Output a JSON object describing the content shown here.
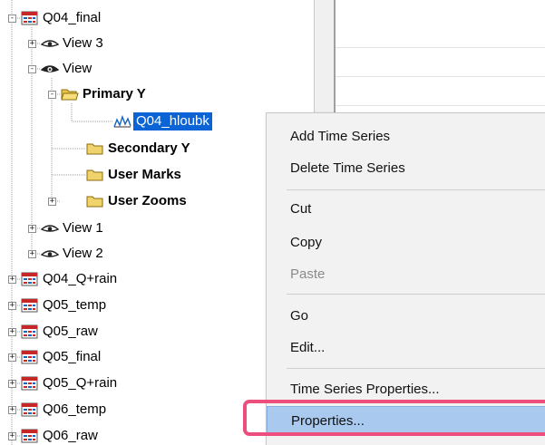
{
  "tree": {
    "items": [
      {
        "label": "Q04_final",
        "exp": "-"
      },
      {
        "label": "View 3",
        "exp": "+"
      },
      {
        "label": "View",
        "exp": "-"
      },
      {
        "label": "Primary Y",
        "exp": "-"
      },
      {
        "label": "Q04_hloubk",
        "exp": ""
      },
      {
        "label": "Secondary Y",
        "exp": ""
      },
      {
        "label": "User Marks",
        "exp": ""
      },
      {
        "label": "User Zooms",
        "exp": "+"
      },
      {
        "label": "View 1",
        "exp": "+"
      },
      {
        "label": "View 2",
        "exp": "+"
      },
      {
        "label": "Q04_Q+rain",
        "exp": "+"
      },
      {
        "label": "Q05_temp",
        "exp": "+"
      },
      {
        "label": "Q05_raw",
        "exp": "+"
      },
      {
        "label": "Q05_final",
        "exp": "+"
      },
      {
        "label": "Q05_Q+rain",
        "exp": "+"
      },
      {
        "label": "Q06_temp",
        "exp": "+"
      },
      {
        "label": "Q06_raw",
        "exp": "+"
      }
    ]
  },
  "context_menu": {
    "items": [
      {
        "label": "Add Time Series",
        "enabled": true
      },
      {
        "label": "Delete Time Series",
        "enabled": true
      },
      {
        "label": "Cut",
        "enabled": true
      },
      {
        "label": "Copy",
        "enabled": true
      },
      {
        "label": "Paste",
        "enabled": false
      },
      {
        "label": "Go",
        "enabled": true
      },
      {
        "label": "Edit...",
        "enabled": true
      },
      {
        "label": "Time Series Properties...",
        "enabled": true
      },
      {
        "label": "Properties...",
        "enabled": true,
        "highlighted": true
      }
    ]
  },
  "colors": {
    "selection": "#0a64d6",
    "menu_highlight": "#a9c9ee",
    "callout_ring": "#ee4e7e"
  }
}
